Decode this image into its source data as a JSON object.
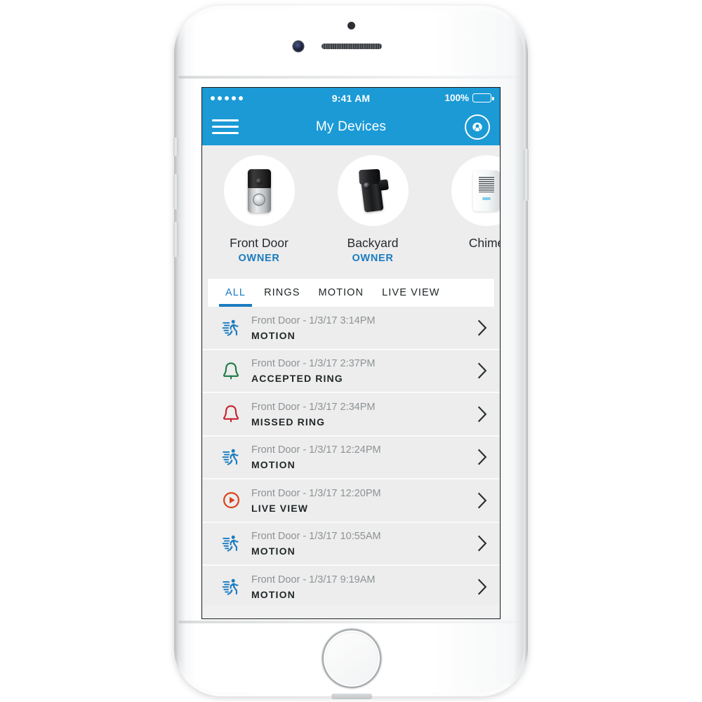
{
  "status_bar": {
    "signal_dots": 5,
    "time": "9:41 AM",
    "battery_percent": "100%",
    "battery_icon": "battery-full-icon"
  },
  "nav": {
    "menu_icon": "hamburger-menu-icon",
    "title": "My Devices",
    "logo_icon": "ring-logo-icon",
    "background_color": "#1b9ad6"
  },
  "devices": [
    {
      "name": "Front Door",
      "role": "OWNER",
      "icon": "video-doorbell-icon"
    },
    {
      "name": "Backyard",
      "role": "OWNER",
      "icon": "stick-up-cam-icon"
    },
    {
      "name": "Chime",
      "role": "",
      "icon": "chime-icon"
    }
  ],
  "tabs": [
    {
      "label": "ALL",
      "active": true
    },
    {
      "label": "RINGS",
      "active": false
    },
    {
      "label": "MOTION",
      "active": false
    },
    {
      "label": "LIVE VIEW",
      "active": false
    }
  ],
  "events": [
    {
      "title": "Front Door - 1/3/17 3:14PM",
      "type": "MOTION",
      "icon": "motion-running-icon",
      "icon_color": "#1b7cc0",
      "chevron": "chevron-right-icon"
    },
    {
      "title": "Front Door - 1/3/17 2:37PM",
      "type": "ACCEPTED RING",
      "icon": "bell-accepted-icon",
      "icon_color": "#1d7a46",
      "chevron": "chevron-right-icon"
    },
    {
      "title": "Front Door - 1/3/17 2:34PM",
      "type": "MISSED RING",
      "icon": "bell-missed-icon",
      "icon_color": "#c8202f",
      "chevron": "chevron-right-icon"
    },
    {
      "title": "Front Door - 1/3/17 12:24PM",
      "type": "MOTION",
      "icon": "motion-running-icon",
      "icon_color": "#1b7cc0",
      "chevron": "chevron-right-icon"
    },
    {
      "title": "Front Door - 1/3/17 12:20PM",
      "type": "LIVE VIEW",
      "icon": "live-view-play-icon",
      "icon_color": "#d8431a",
      "chevron": "chevron-right-icon"
    },
    {
      "title": "Front Door - 1/3/17 10:55AM",
      "type": "MOTION",
      "icon": "motion-running-icon",
      "icon_color": "#1b7cc0",
      "chevron": "chevron-right-icon"
    },
    {
      "title": "Front Door - 1/3/17 9:19AM",
      "type": "MOTION",
      "icon": "motion-running-icon",
      "icon_color": "#1b7cc0",
      "chevron": "chevron-right-icon"
    }
  ],
  "theme": {
    "accent_blue": "#1b9ad6",
    "link_blue": "#1b7cc0",
    "list_background": "#ededed",
    "card_background": "#ffffff"
  }
}
